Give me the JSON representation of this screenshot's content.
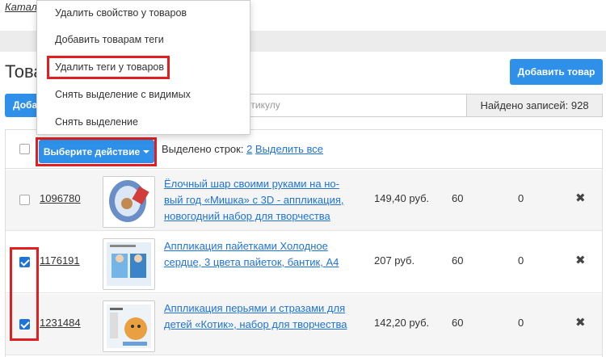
{
  "breadcrumb": "Катало",
  "page_title": "Това",
  "add_product_button": "Добавить товар",
  "left_blue_button": "Доба",
  "search": {
    "placeholder": "ртикулу"
  },
  "found_records": "Найдено записей: 928",
  "header": {
    "action_button": "Выберите действие",
    "selected_prefix": "Выделено строк: ",
    "selected_count": "2",
    "select_all": "Выделить все"
  },
  "menu": {
    "items": [
      "Удалить свойство у товаров",
      "Добавить товарам теги",
      "Удалить теги у товаров",
      "Снять выделение с видимых",
      "Снять выделение"
    ]
  },
  "rows": [
    {
      "id": "1096780",
      "checked": false,
      "title": "Ёлочный шар своими руками на но-вый год «Мишка» с 3D - аппликация, новогодний набор для творчества",
      "price": "149,40 руб.",
      "qty": "60",
      "zero": "0",
      "delete": "✖"
    },
    {
      "id": "1176191",
      "checked": true,
      "title": "Аппликация пайетками Холодное сердце, 3 цвета пайеток, бантик, А4",
      "price": "207 руб.",
      "qty": "60",
      "zero": "0",
      "delete": "✖"
    },
    {
      "id": "1231484",
      "checked": true,
      "title": "Аппликация перьями и стразами для детей «Котик», набор для творчества",
      "price": "142,20 руб.",
      "qty": "60",
      "zero": "0",
      "delete": "✖"
    }
  ],
  "colors": {
    "accent": "#2e90e8",
    "link": "#1e73d8",
    "highlight": "#e02020"
  }
}
